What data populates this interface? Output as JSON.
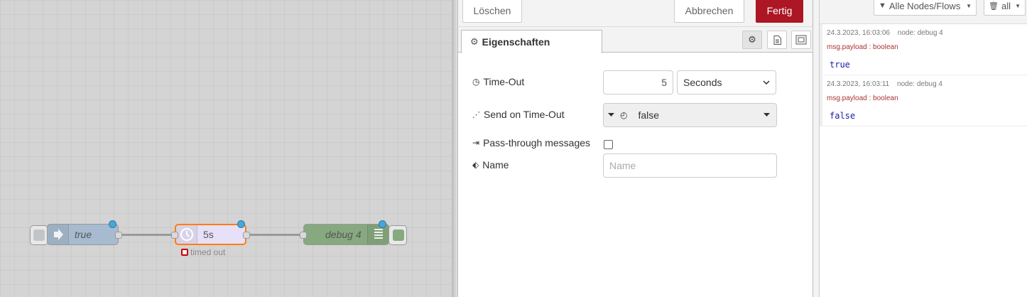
{
  "flow": {
    "inject_node": {
      "label": "true"
    },
    "trigger_node": {
      "label": "5s",
      "status": "timed out"
    },
    "debug_node": {
      "label": "debug 4"
    }
  },
  "editor": {
    "buttons": {
      "delete": "Löschen",
      "cancel": "Abbrechen",
      "done": "Fertig"
    },
    "tab_properties": "Eigenschaften",
    "fields": {
      "timeout_label": "Time-Out",
      "timeout_value": "5",
      "timeout_unit": "Seconds",
      "send_label": "Send on Time-Out",
      "send_value": "false",
      "passthrough_label": "Pass-through messages",
      "passthrough_checked": false,
      "name_label": "Name",
      "name_placeholder": "Name"
    }
  },
  "debug_sidebar": {
    "filter_label": "Alle Nodes/Flows",
    "clear_label": "all",
    "messages": [
      {
        "timestamp": "24.3.2023, 16:03:06",
        "node": "node: debug 4",
        "topic": "msg.payload : boolean",
        "value": "true"
      },
      {
        "timestamp": "24.3.2023, 16:03:11",
        "node": "node: debug 4",
        "topic": "msg.payload : boolean",
        "value": "false"
      }
    ]
  },
  "colors": {
    "primary_button": "#ad1625",
    "inject_node": "#a6bbcf",
    "trigger_node": "#e6e0f8",
    "trigger_border": "#ff7f0e",
    "debug_node": "#87a980",
    "changed_dot": "#49a6d7"
  }
}
